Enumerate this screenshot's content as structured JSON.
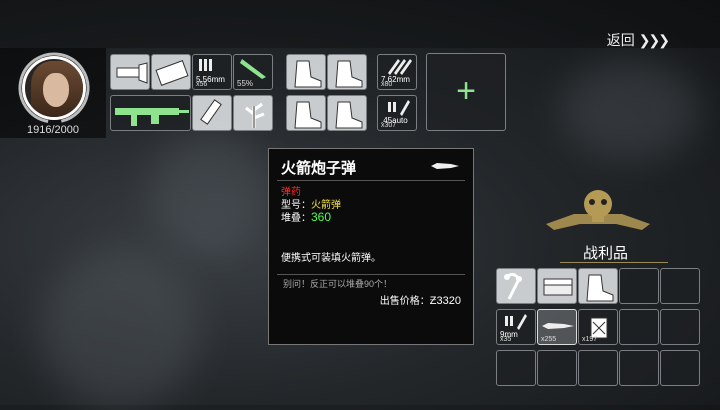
{
  "header": {
    "back_label": "返回",
    "back_chevrons": "❯❯❯"
  },
  "character": {
    "hp_text": "1916/2000"
  },
  "inventory": {
    "slots": [
      {
        "name": "flashlight",
        "bright": true
      },
      {
        "name": "tape",
        "bright": true
      },
      {
        "name": "ammo-556",
        "label": "5.56mm",
        "count": "x56"
      },
      {
        "name": "knife",
        "percent": "55%"
      },
      {
        "name": "rifle",
        "bright": false
      },
      {
        "name": "syringe",
        "bright": true
      },
      {
        "name": "herb",
        "bright": true
      },
      {
        "name": "boot-1",
        "bright": true
      },
      {
        "name": "boot-2",
        "bright": true
      },
      {
        "name": "boot-3",
        "bright": true
      },
      {
        "name": "boot-4",
        "bright": true
      },
      {
        "name": "ammo-762",
        "label": "7.62mm",
        "count": "x80"
      },
      {
        "name": "ammo-45",
        "label": ".45auto",
        "count": "x307"
      }
    ],
    "add_label": "+"
  },
  "tooltip": {
    "title": "火箭炮子弹",
    "category": "弹药",
    "model_label": "型号：",
    "model_value": "火箭弹",
    "stack_label": "堆叠：",
    "stack_value": "360",
    "description": "便携式可装填火箭弹。",
    "note": "别问！反正可以堆叠90个！",
    "price_label": "出售价格：",
    "price_value": "Ƶ3320"
  },
  "loot": {
    "title": "战利品",
    "slots": [
      {
        "name": "earphones"
      },
      {
        "name": "cash-stack"
      },
      {
        "name": "boot"
      },
      {
        "name": "ammo-9mm",
        "label": "9mm",
        "count": "x35"
      },
      {
        "name": "rocket-ammo",
        "count": "x255"
      },
      {
        "name": "fuel-can",
        "count": "x197"
      }
    ]
  },
  "colors": {
    "accent_green": "#8fe38f",
    "category_red": "#ff2a2a",
    "model_yellow": "#f0e04a",
    "stack_green": "#4cff4c"
  }
}
